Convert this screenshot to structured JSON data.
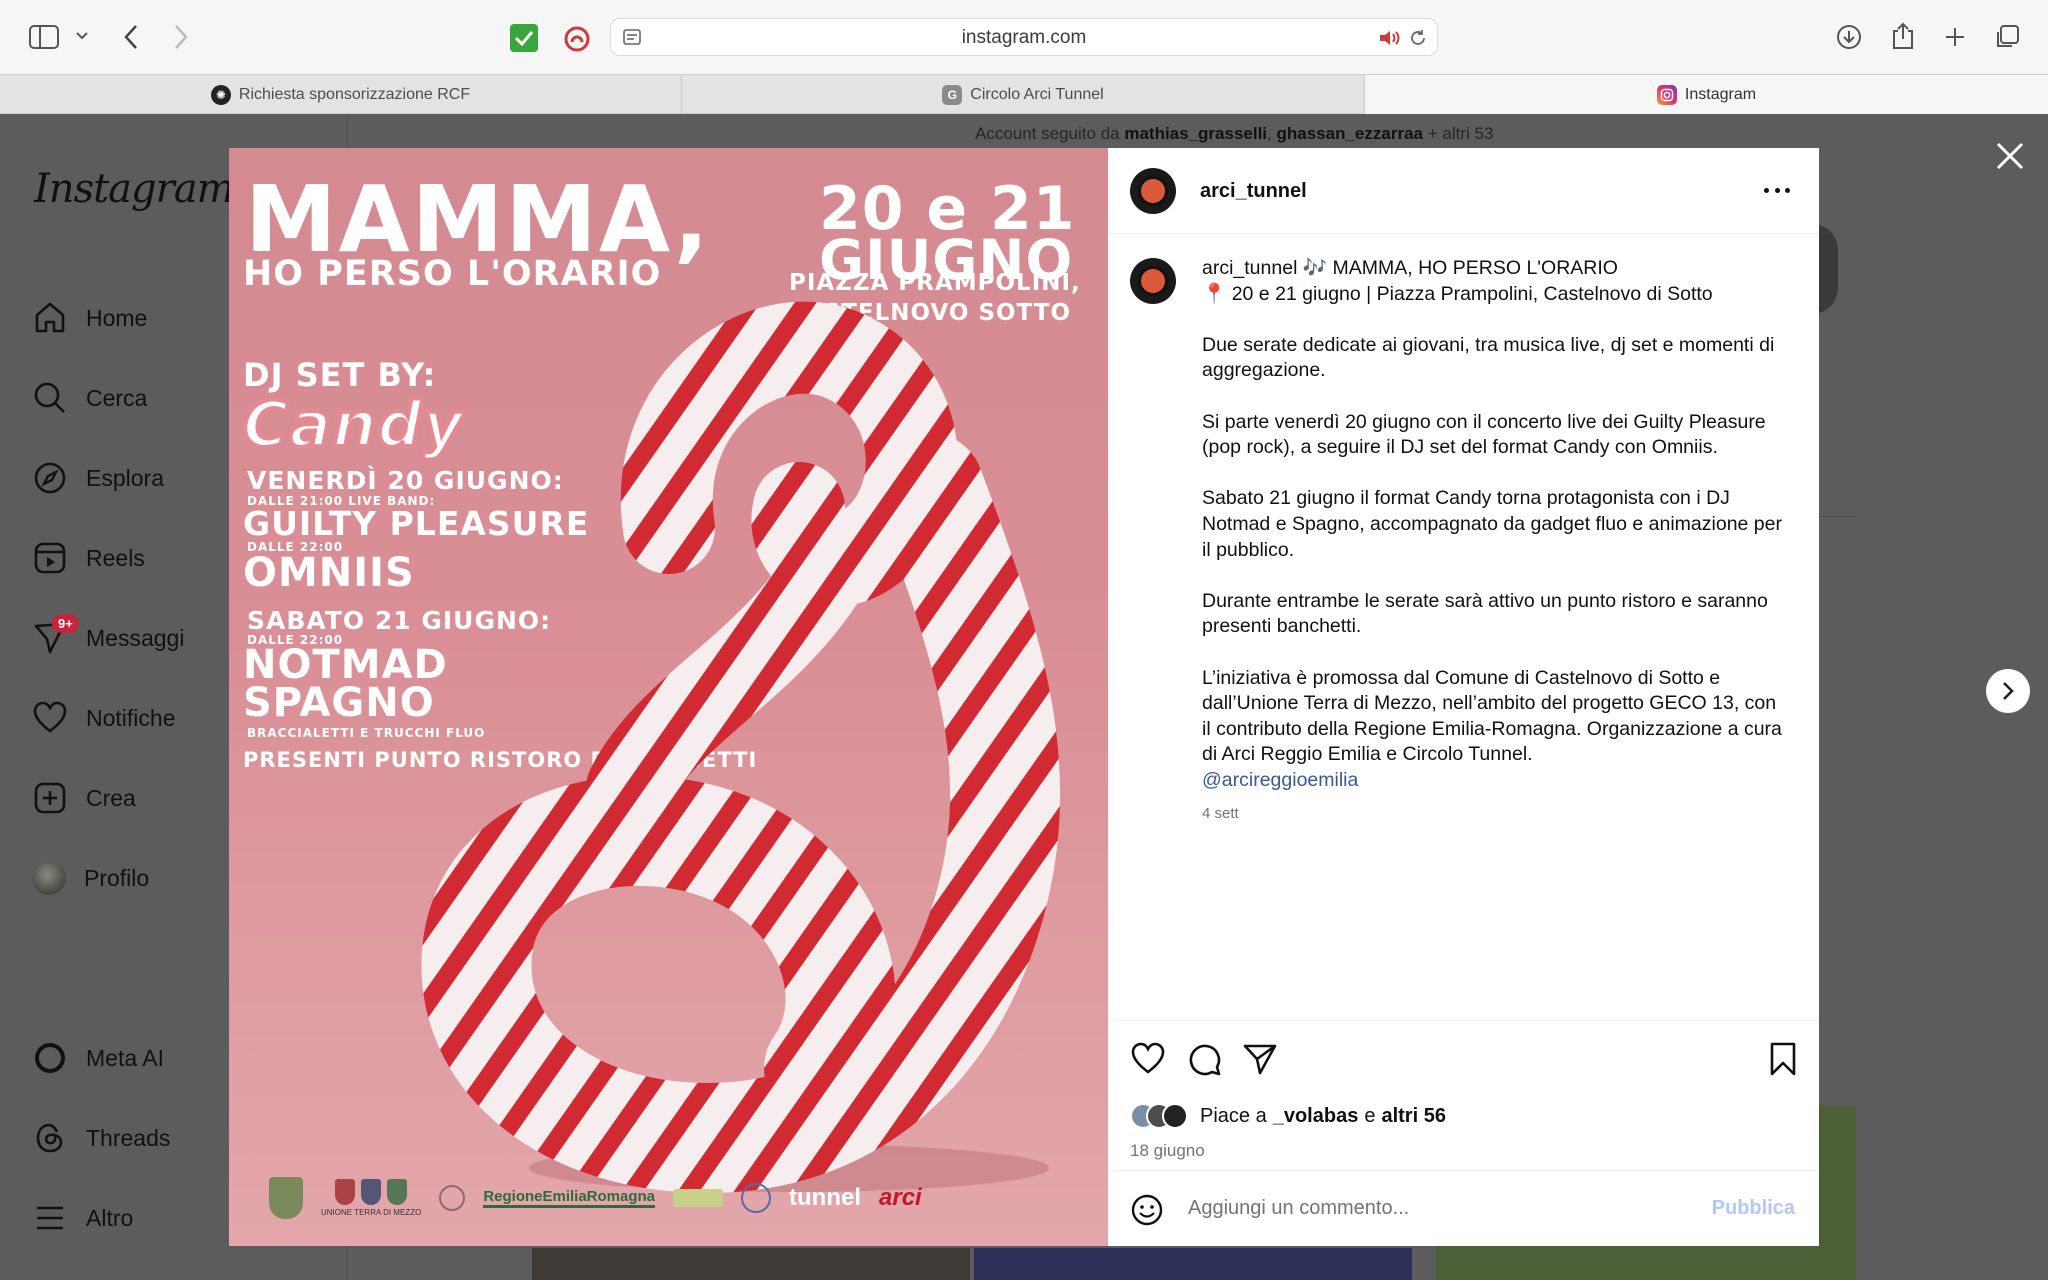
{
  "browser": {
    "url": "instagram.com",
    "tabs": [
      {
        "label": "Richiesta sponsorizzazione RCF",
        "active": false
      },
      {
        "label": "Circolo Arci Tunnel",
        "active": false
      },
      {
        "label": "Instagram",
        "active": true
      }
    ]
  },
  "sidebar": {
    "logo": "Instagram",
    "items": [
      {
        "label": "Home",
        "icon": "home-icon"
      },
      {
        "label": "Cerca",
        "icon": "search-icon"
      },
      {
        "label": "Esplora",
        "icon": "compass-icon"
      },
      {
        "label": "Reels",
        "icon": "reels-icon"
      },
      {
        "label": "Messaggi",
        "icon": "messenger-icon",
        "badge": "9+"
      },
      {
        "label": "Notifiche",
        "icon": "heart-icon"
      },
      {
        "label": "Crea",
        "icon": "plus-square-icon"
      },
      {
        "label": "Profilo",
        "icon": "avatar"
      },
      {
        "label": "Meta AI",
        "icon": "meta-ai-icon"
      },
      {
        "label": "Threads",
        "icon": "threads-icon"
      },
      {
        "label": "Altro",
        "icon": "menu-icon"
      }
    ]
  },
  "background": {
    "followed_prefix": "Account seguito da",
    "followed_user1": "mathias_grasselli",
    "followed_user2": "ghassan_ezzarraa",
    "followed_suffix": "+ altri 53"
  },
  "poster": {
    "title1": "MAMMA,",
    "title2": "HO PERSO L'ORARIO",
    "date_top": "20 e 21",
    "date_month": "GIUGNO",
    "place1": "PIAZZA PRAMPOLINI,",
    "place2": "CASTELNOVO SOTTO",
    "dj_by": "DJ SET BY:",
    "candy": "Candy",
    "fri": "VENERDÌ 20 GIUGNO:",
    "fri_time": "DALLE 21:00 LIVE BAND:",
    "fri_band": "GUILTY PLEASURE",
    "fri_time2": "DALLE 22:00",
    "fri_dj": "OMNIIS",
    "sat": "SABATO 21 GIUGNO:",
    "sat_time": "DALLE 22:00",
    "sat_dj1": "NOTMAD",
    "sat_dj2": "SPAGNO",
    "gadgets": "BRACCIALETTI E TRUCCHI FLUO",
    "food": "PRESENTI PUNTO RISTORO E BANCHETTI",
    "logo_union": "UNIONE TERRA DI MEZZO",
    "logo_region": "RegioneEmiliaRomagna",
    "logo_tunnel": "tunnel",
    "logo_arci": "arci"
  },
  "post": {
    "username": "arci_tunnel",
    "caption_line1": "🎶 MAMMA, HO PERSO L'ORARIO",
    "caption_line2": "📍 20 e 21 giugno | Piazza Prampolini, Castelnovo di Sotto",
    "para1": "Due serate dedicate ai giovani, tra musica live, dj set e momenti di aggregazione.",
    "para2": "Si parte venerdì 20 giugno con il concerto live dei Guilty Pleasure (pop rock), a seguire il DJ set del format Candy con Omniis.",
    "para3": "Sabato 21 giugno il format Candy torna protagonista con i DJ Notmad e Spagno, accompagnato da gadget fluo e animazione per il pubblico.",
    "para4": "Durante entrambe le serate sarà attivo un punto ristoro e saranno presenti banchetti.",
    "para5": "L’iniziativa è promossa dal Comune di Castelnovo di Sotto e dall’Unione Terra di Mezzo, nell’ambito del progetto GECO 13, con il contributo della Regione Emilia-Romagna. Organizzazione a cura di Arci Reggio Emilia e Circolo Tunnel.",
    "mention": "@arcireggioemilia",
    "caption_age": "4 sett",
    "likes_prefix": "Piace a",
    "likes_user": "_volabas",
    "likes_mid": "e",
    "likes_others": "altri 56",
    "date": "18 giugno",
    "comment_placeholder": "Aggiungi un commento...",
    "publish_label": "Pubblica"
  }
}
